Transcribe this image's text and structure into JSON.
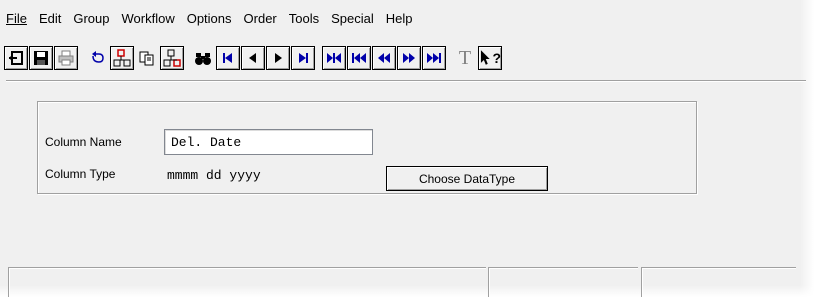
{
  "menu": [
    {
      "label": "File",
      "name": "menu-file"
    },
    {
      "label": "Edit",
      "name": "menu-edit"
    },
    {
      "label": "Group",
      "name": "menu-group"
    },
    {
      "label": "Workflow",
      "name": "menu-workflow"
    },
    {
      "label": "Options",
      "name": "menu-options"
    },
    {
      "label": "Order",
      "name": "menu-order"
    },
    {
      "label": "Tools",
      "name": "menu-tools"
    },
    {
      "label": "Special",
      "name": "menu-special"
    },
    {
      "label": "Help",
      "name": "menu-help"
    }
  ],
  "toolbar": {
    "icons": [
      "exit-icon",
      "save-icon",
      "print-icon",
      "undo-icon",
      "insert-field-icon",
      "copy-icon",
      "insert-field-below-icon",
      "find-icon",
      "first-record-icon",
      "previous-record-icon",
      "next-record-icon",
      "last-record-icon",
      "first-page-icon",
      "first-icon",
      "rewind-icon",
      "forward-icon",
      "last-page-icon",
      "text-icon",
      "context-help-icon"
    ],
    "text_glyph": "T",
    "help_glyph": "?"
  },
  "form": {
    "column_name_label": "Column Name",
    "column_name_value": "Del. Date",
    "column_type_label": "Column Type",
    "column_type_value": "mmmm dd yyyy",
    "choose_datatype_label": "Choose DataType"
  },
  "colors": {
    "accent": "#0000aa",
    "red": "#cc0000",
    "window_bg": "#f0f0f0"
  }
}
